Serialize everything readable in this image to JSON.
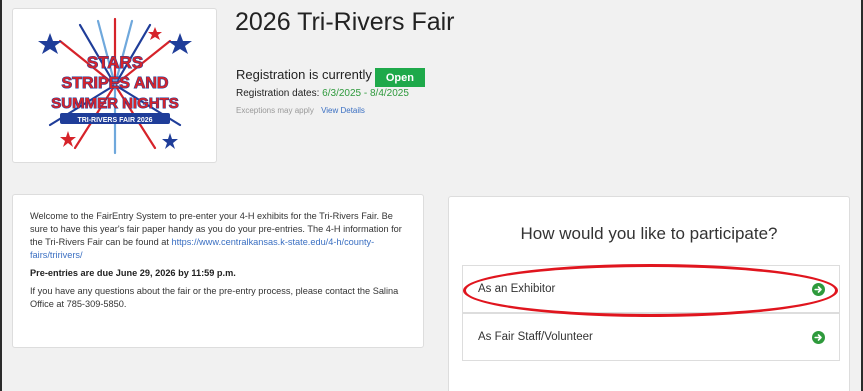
{
  "event": {
    "title": "2026 Tri-Rivers Fair"
  },
  "logo": {
    "lines": [
      "STARS",
      "STRIPES AND",
      "SUMMER NIGHTS"
    ],
    "ribbon": "TRI-RIVERS FAIR 2026"
  },
  "registration": {
    "status_prefix": "Registration is currently",
    "status": "Open",
    "dates_label": "Registration dates:",
    "dates_value": "6/3/2025 - 8/4/2025",
    "exceptions": "Exceptions may apply",
    "view_details": "View Details"
  },
  "info": {
    "intro": "Welcome to the FairEntry System to pre-enter your 4-H exhibits for the Tri-Rivers Fair. Be sure to have this year's fair paper handy as you do your pre-entries. The 4-H information for the Tri-Rivers Fair can be found at",
    "link": "https://www.centralkansas.k-state.edu/4-h/county-fairs/tririvers/",
    "deadline": "Pre-entries are due June 29, 2026 by 11:59 p.m.",
    "contact": "If you have any questions about the fair or the pre-entry process, please contact the Salina Office at 785-309-5850."
  },
  "participate": {
    "heading": "How would you like to participate?",
    "options": [
      {
        "label": "As an Exhibitor"
      },
      {
        "label": "As Fair Staff/Volunteer"
      }
    ]
  },
  "colors": {
    "open_badge": "#1ea94a",
    "date_text": "#2e9a3c",
    "link": "#3a6fc2",
    "annotation": "#e0151e"
  },
  "icons": {
    "option_arrow": "arrow-circle-right-icon"
  }
}
